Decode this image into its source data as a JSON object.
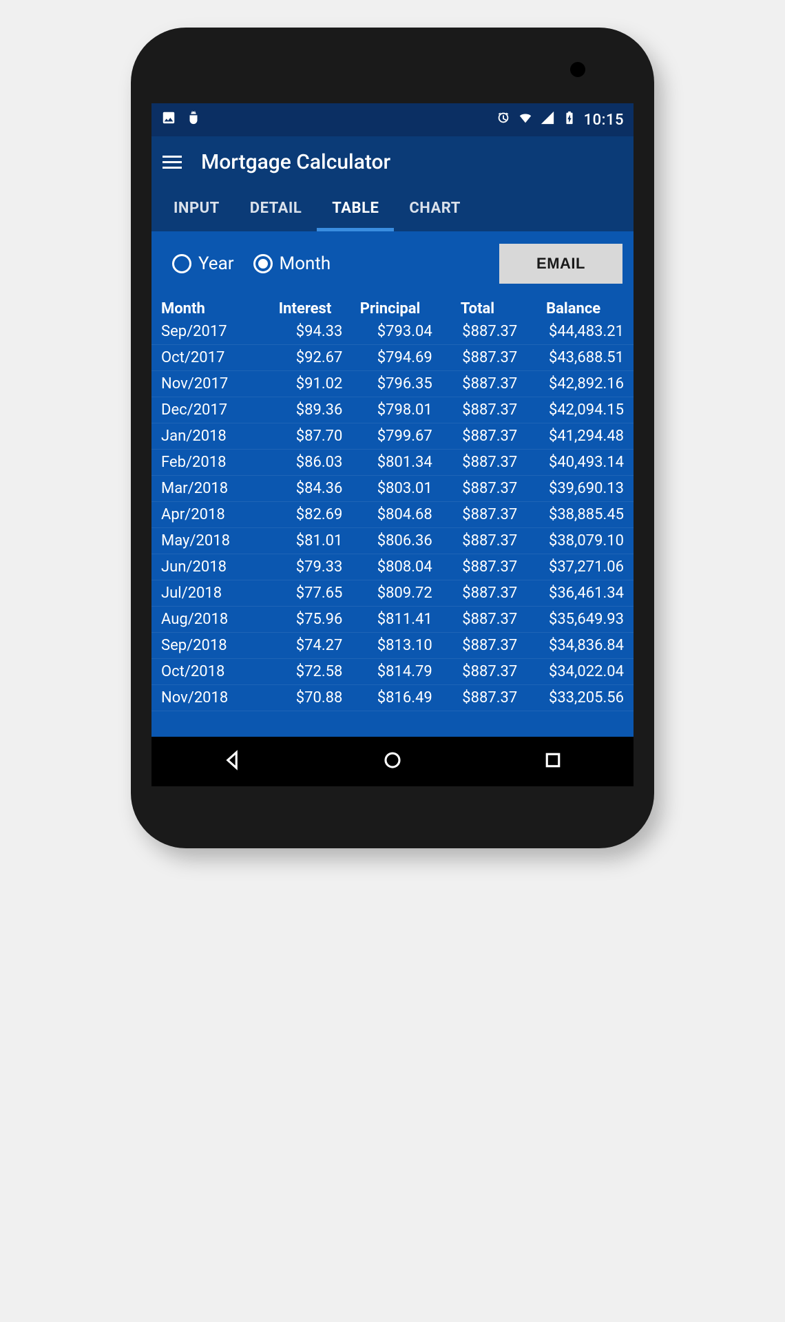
{
  "status": {
    "clock": "10:15"
  },
  "app": {
    "title": "Mortgage Calculator"
  },
  "tabs": [
    {
      "label": "INPUT",
      "active": false
    },
    {
      "label": "DETAIL",
      "active": false
    },
    {
      "label": "TABLE",
      "active": true
    },
    {
      "label": "CHART",
      "active": false
    }
  ],
  "controls": {
    "radio_year": {
      "label": "Year",
      "selected": false
    },
    "radio_month": {
      "label": "Month",
      "selected": true
    },
    "email_button": "EMAIL"
  },
  "table": {
    "headers": {
      "month": "Month",
      "interest": "Interest",
      "principal": "Principal",
      "total": "Total",
      "balance": "Balance"
    },
    "rows": [
      {
        "month": "Sep/2017",
        "interest": "$94.33",
        "principal": "$793.04",
        "total": "$887.37",
        "balance": "$44,483.21"
      },
      {
        "month": "Oct/2017",
        "interest": "$92.67",
        "principal": "$794.69",
        "total": "$887.37",
        "balance": "$43,688.51"
      },
      {
        "month": "Nov/2017",
        "interest": "$91.02",
        "principal": "$796.35",
        "total": "$887.37",
        "balance": "$42,892.16"
      },
      {
        "month": "Dec/2017",
        "interest": "$89.36",
        "principal": "$798.01",
        "total": "$887.37",
        "balance": "$42,094.15"
      },
      {
        "month": "Jan/2018",
        "interest": "$87.70",
        "principal": "$799.67",
        "total": "$887.37",
        "balance": "$41,294.48"
      },
      {
        "month": "Feb/2018",
        "interest": "$86.03",
        "principal": "$801.34",
        "total": "$887.37",
        "balance": "$40,493.14"
      },
      {
        "month": "Mar/2018",
        "interest": "$84.36",
        "principal": "$803.01",
        "total": "$887.37",
        "balance": "$39,690.13"
      },
      {
        "month": "Apr/2018",
        "interest": "$82.69",
        "principal": "$804.68",
        "total": "$887.37",
        "balance": "$38,885.45"
      },
      {
        "month": "May/2018",
        "interest": "$81.01",
        "principal": "$806.36",
        "total": "$887.37",
        "balance": "$38,079.10"
      },
      {
        "month": "Jun/2018",
        "interest": "$79.33",
        "principal": "$808.04",
        "total": "$887.37",
        "balance": "$37,271.06"
      },
      {
        "month": "Jul/2018",
        "interest": "$77.65",
        "principal": "$809.72",
        "total": "$887.37",
        "balance": "$36,461.34"
      },
      {
        "month": "Aug/2018",
        "interest": "$75.96",
        "principal": "$811.41",
        "total": "$887.37",
        "balance": "$35,649.93"
      },
      {
        "month": "Sep/2018",
        "interest": "$74.27",
        "principal": "$813.10",
        "total": "$887.37",
        "balance": "$34,836.84"
      },
      {
        "month": "Oct/2018",
        "interest": "$72.58",
        "principal": "$814.79",
        "total": "$887.37",
        "balance": "$34,022.04"
      },
      {
        "month": "Nov/2018",
        "interest": "$70.88",
        "principal": "$816.49",
        "total": "$887.37",
        "balance": "$33,205.56"
      }
    ]
  }
}
